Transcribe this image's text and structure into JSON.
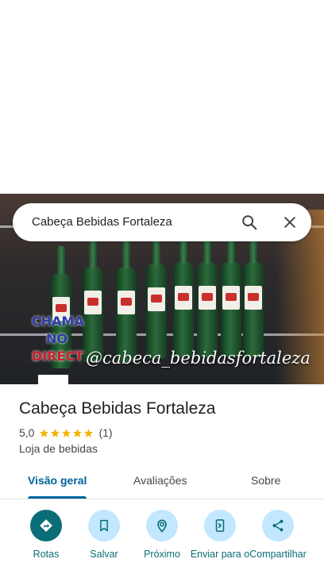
{
  "search": {
    "value": "Cabeça Bebidas Fortaleza"
  },
  "hero": {
    "overlay_handle": "@cabeca_bebidasfortaleza",
    "promo_lines": [
      "CHAMA",
      "NO",
      "DIRECT"
    ]
  },
  "place": {
    "title": "Cabeça Bebidas Fortaleza",
    "rating": "5,0",
    "stars": 5,
    "review_count": "(1)",
    "category": "Loja de bebidas"
  },
  "tabs": [
    {
      "label": "Visão geral",
      "active": true
    },
    {
      "label": "Avaliações",
      "active": false
    },
    {
      "label": "Sobre",
      "active": false
    }
  ],
  "actions": [
    {
      "label": "Rotas",
      "icon": "directions-icon"
    },
    {
      "label": "Salvar",
      "icon": "bookmark-icon"
    },
    {
      "label": "Próximo",
      "icon": "nearby-icon"
    },
    {
      "label": "Enviar para o",
      "icon": "send-to-phone-icon"
    },
    {
      "label": "Compartilhar",
      "icon": "share-icon"
    }
  ],
  "colors": {
    "accent": "#00639b",
    "action_text": "#0b6d77",
    "action_bg": "#c2e7ff",
    "star": "#f4b400"
  }
}
